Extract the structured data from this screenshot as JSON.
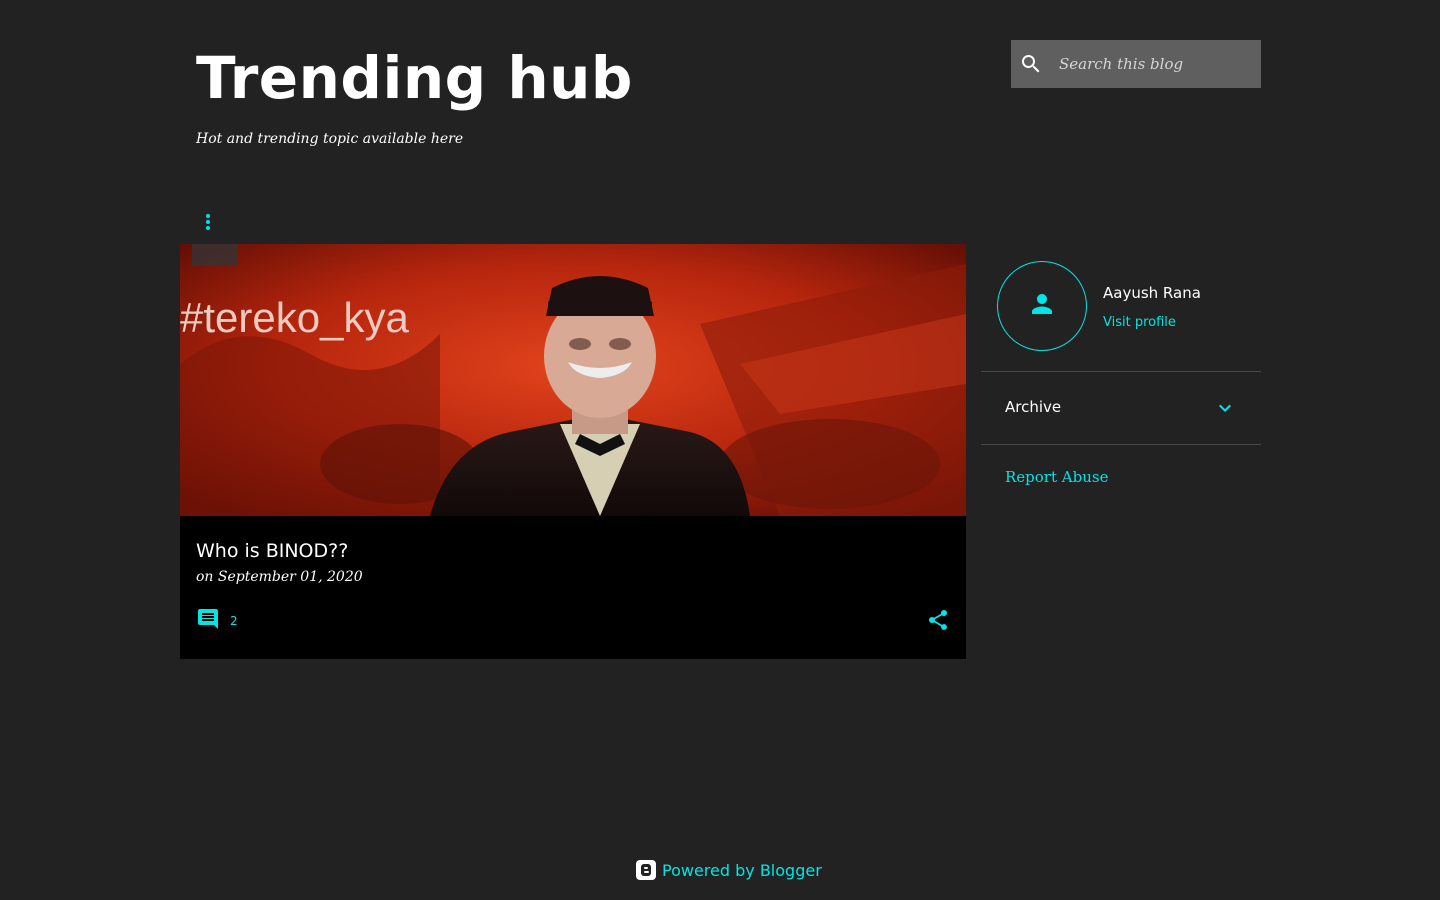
{
  "header": {
    "blog_title": "Trending hub",
    "blog_description": "Hot and trending topic available here"
  },
  "search": {
    "placeholder": "Search this blog",
    "icon": "search-icon"
  },
  "post": {
    "image_overlay_text": "#tereko_kya",
    "title": "Who is BINOD??",
    "date": "on September 01, 2020",
    "comment_count": "2",
    "icons": [
      "comment-icon",
      "share-icon"
    ]
  },
  "profile": {
    "name": "Aayush Rana",
    "visit_label": "Visit profile",
    "icon": "person-icon"
  },
  "archive": {
    "label": "Archive",
    "icon": "chevron-down-icon"
  },
  "report_abuse": "Report Abuse",
  "footer": {
    "powered_by": "Powered by Blogger",
    "icon": "blogger-icon"
  },
  "colors": {
    "background": "#222222",
    "accent": "#00e5e5",
    "card": "#000000",
    "search_box": "#5f5f5f"
  }
}
